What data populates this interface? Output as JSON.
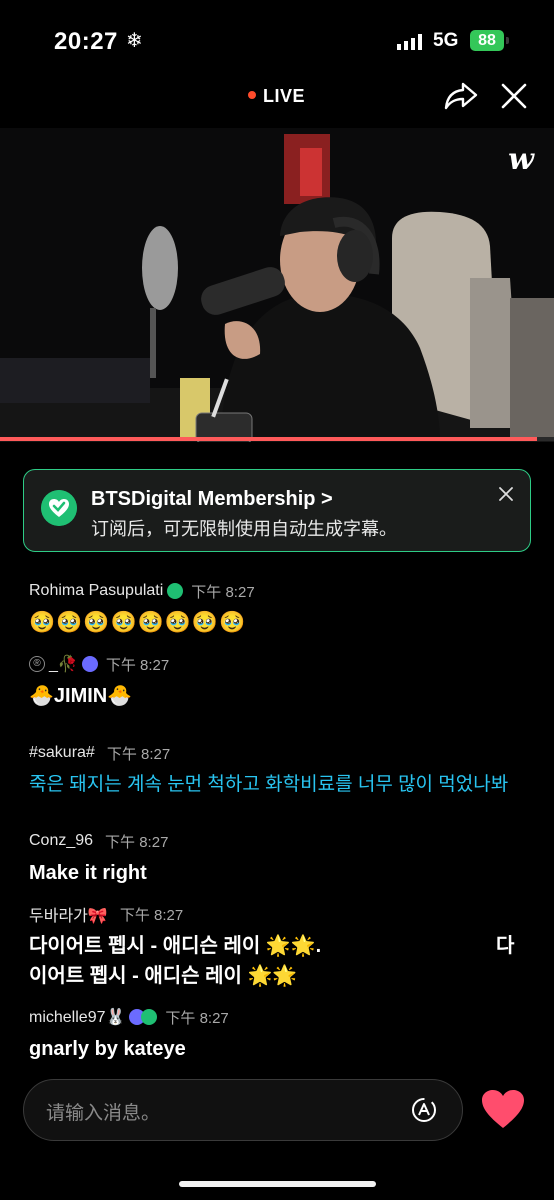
{
  "status_bar": {
    "time": "20:27",
    "weather_glyph": "❄",
    "network": "5G",
    "battery": "88"
  },
  "top_bar": {
    "live_label": "LIVE"
  },
  "video": {
    "logo_text": "w",
    "progress": 0.97
  },
  "banner": {
    "title": "BTSDigital Membership >",
    "subtitle": "订阅后，可无限制使用自动生成字幕。"
  },
  "messages": [
    {
      "user": "Rohima Pasupulati",
      "time": "下午 8:27",
      "text": "🥹🥹🥹🥹🥹🥹🥹🥹"
    },
    {
      "user": "_🥀",
      "time": "下午 8:27",
      "text": "🐣JIMIN🐣"
    },
    {
      "user": "#sakura#",
      "time": "下午 8:27",
      "text": "죽은 돼지는 계속 눈먼 척하고 화학비료를 너무 많이 먹었나봐"
    },
    {
      "user": "Conz_96",
      "time": "下午 8:27",
      "text": "Make it right"
    },
    {
      "user": "두바라가🎀",
      "time": "下午 8:27",
      "text_line1": "다이어트 펩시 - 애디슨 레이 🌟🌟.",
      "text_line1_tail": "다",
      "text_line2": "이어트 펩시 - 애디슨 레이 🌟🌟"
    },
    {
      "user": "michelle97🐰",
      "time": "下午 8:27",
      "text": "gnarly by kateye"
    }
  ],
  "input": {
    "placeholder": "请输入消息。"
  },
  "colors": {
    "accent_green": "#1fbf73",
    "live_red": "#ff4b2b",
    "link_blue": "#29c4f0",
    "heart": "#ff4d6d"
  }
}
